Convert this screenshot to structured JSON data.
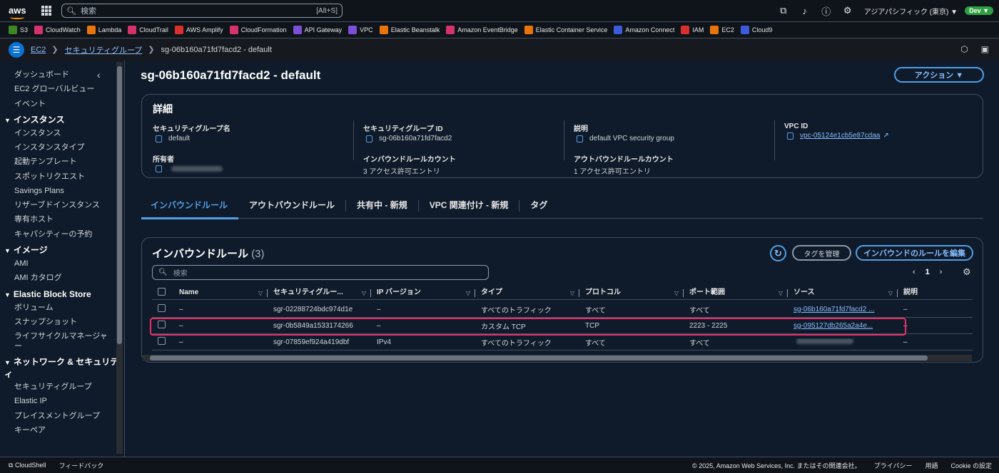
{
  "topbar": {
    "logo": "aws",
    "search_placeholder": "検索",
    "search_shortcut": "[Alt+S]",
    "region": "アジアパシフィック (東京) ▼",
    "profile_badge": "Dev ▼"
  },
  "favorites": [
    {
      "label": "S3",
      "color": "#3f8624",
      "icon": "s3-icon"
    },
    {
      "label": "CloudWatch",
      "color": "#d6336c",
      "icon": "cloudwatch-icon"
    },
    {
      "label": "Lambda",
      "color": "#e8740c",
      "icon": "lambda-icon"
    },
    {
      "label": "CloudTrail",
      "color": "#d6336c",
      "icon": "cloudtrail-icon"
    },
    {
      "label": "AWS Amplify",
      "color": "#d9302d",
      "icon": "amplify-icon"
    },
    {
      "label": "CloudFormation",
      "color": "#d6336c",
      "icon": "cloudformation-icon"
    },
    {
      "label": "API Gateway",
      "color": "#7b4fd6",
      "icon": "api-gateway-icon"
    },
    {
      "label": "VPC",
      "color": "#7b4fd6",
      "icon": "vpc-icon"
    },
    {
      "label": "Elastic Beanstalk",
      "color": "#e8740c",
      "icon": "beanstalk-icon"
    },
    {
      "label": "Amazon EventBridge",
      "color": "#d6336c",
      "icon": "eventbridge-icon"
    },
    {
      "label": "Elastic Container Service",
      "color": "#e8740c",
      "icon": "ecs-icon"
    },
    {
      "label": "Amazon Connect",
      "color": "#3b5bdb",
      "icon": "connect-icon"
    },
    {
      "label": "IAM",
      "color": "#d9302d",
      "icon": "iam-icon"
    },
    {
      "label": "EC2",
      "color": "#e8740c",
      "icon": "ec2-icon"
    },
    {
      "label": "Cloud9",
      "color": "#3b5bdb",
      "icon": "cloud9-icon"
    }
  ],
  "breadcrumb": {
    "ec2": "EC2",
    "sg": "セキュリティグループ",
    "current": "sg-06b160a71fd7facd2 - default"
  },
  "sidebar": {
    "top_items": [
      "ダッシュボード",
      "EC2 グローバルビュー",
      "イベント"
    ],
    "sections": [
      {
        "title": "インスタンス",
        "items": [
          "インスタンス",
          "インスタンスタイプ",
          "起動テンプレート",
          "スポットリクエスト",
          "Savings Plans",
          "リザーブドインスタンス",
          "専有ホスト",
          "キャパシティーの予約"
        ]
      },
      {
        "title": "イメージ",
        "items": [
          "AMI",
          "AMI カタログ"
        ]
      },
      {
        "title": "Elastic Block Store",
        "items": [
          "ボリューム",
          "スナップショット",
          "ライフサイクルマネージャー"
        ]
      },
      {
        "title": "ネットワーク & セキュリティ",
        "items": [
          "セキュリティグループ",
          "Elastic IP",
          "プレイスメントグループ",
          "キーペア"
        ]
      }
    ]
  },
  "page": {
    "title": "sg-06b160a71fd7facd2 - default",
    "action_button": "アクション ▼"
  },
  "details": {
    "heading": "詳細",
    "sg_name_label": "セキュリティグループ名",
    "sg_name_value": "default",
    "sg_id_label": "セキュリティグループ ID",
    "sg_id_value": "sg-06b160a71fd7facd2",
    "desc_label": "説明",
    "desc_value": "default VPC security group",
    "vpc_label": "VPC ID",
    "vpc_value": "vpc-05124e1cb5e87cdaa",
    "owner_label": "所有者",
    "inbound_count_label": "インバウンドルールカウント",
    "inbound_count_value": "3 アクセス許可エントリ",
    "outbound_count_label": "アウトバウンドルールカウント",
    "outbound_count_value": "1 アクセス許可エントリ"
  },
  "tabs": [
    "インバウンドルール",
    "アウトバウンドルール",
    "共有中 - 新規",
    "VPC 関連付け - 新規",
    "タグ"
  ],
  "rules": {
    "title": "インバウンドルール",
    "count": "(3)",
    "manage_tags": "タグを管理",
    "edit_rules": "インバウンドのルールを編集",
    "search_placeholder": "検索",
    "page": "1",
    "columns": [
      "Name",
      "セキュリティグルー...",
      "IP バージョン",
      "タイプ",
      "プロトコル",
      "ポート範囲",
      "ソース",
      "説明"
    ],
    "rows": [
      [
        "–",
        "sgr-02288724bdc974d1e",
        "–",
        "すべてのトラフィック",
        "すべて",
        "すべて",
        "sg-06b160a71fd7facd2 ...",
        "–"
      ],
      [
        "–",
        "sgr-0b5849a1533174266",
        "–",
        "カスタム TCP",
        "TCP",
        "2223 - 2225",
        "sg-095127db265a2a4e...",
        "–"
      ],
      [
        "–",
        "sgr-07859ef924a419dbf",
        "IPv4",
        "すべてのトラフィック",
        "すべて",
        "すべて",
        "",
        "–"
      ]
    ]
  },
  "footer": {
    "cloudshell": "CloudShell",
    "feedback": "フィードバック",
    "copyright": "© 2025, Amazon Web Services, Inc. またはその関連会社。",
    "privacy": "プライバシー",
    "terms": "用語",
    "cookie": "Cookie の設定"
  }
}
